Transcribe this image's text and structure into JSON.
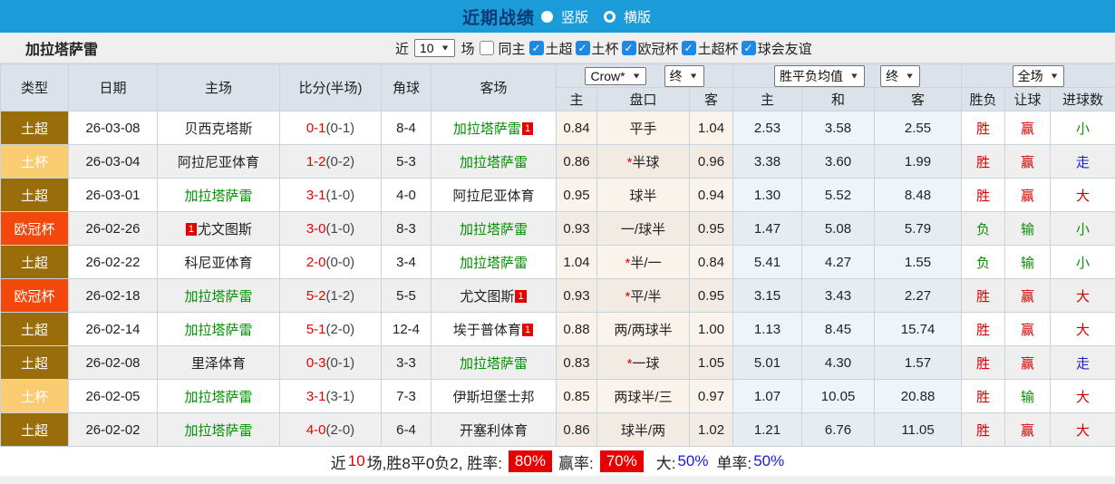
{
  "topbar": {
    "title": "近期战绩",
    "vertical_label": "竖版",
    "horizontal_label": "横版"
  },
  "filterbar": {
    "team": "加拉塔萨雷",
    "near_label": "近",
    "games_value": "10",
    "games_label": "场",
    "same_home_label": "同主",
    "leagues": [
      {
        "label": "土超",
        "checked": true
      },
      {
        "label": "土杯",
        "checked": true
      },
      {
        "label": "欧冠杯",
        "checked": true
      },
      {
        "label": "土超杯",
        "checked": true
      },
      {
        "label": "球会友谊",
        "checked": true
      }
    ],
    "check_glyph": "✓"
  },
  "table": {
    "headers_left": [
      "类型",
      "日期",
      "主场",
      "比分(半场)",
      "角球",
      "客场"
    ],
    "dropdowns": {
      "crow": "Crow*",
      "end1": "终",
      "avg": "胜平负均值",
      "end2": "终",
      "full": "全场"
    },
    "subheaders": [
      "主",
      "盘口",
      "客",
      "主",
      "和",
      "客",
      "胜负",
      "让球",
      "进球数"
    ],
    "rows": [
      {
        "type": "土超",
        "date": "26-03-08",
        "home": "贝西克塔斯",
        "home_green": false,
        "home_badge": "",
        "score": "0-1",
        "half": "(0-1)",
        "corner": "8-4",
        "away": "加拉塔萨雷",
        "away_green": true,
        "away_badge": "1",
        "odds_home": "0.84",
        "star": false,
        "handicap": "平手",
        "odds_away": "1.04",
        "avg_win": "2.53",
        "avg_draw": "3.58",
        "avg_lose": "2.55",
        "result_wdl": "胜",
        "result_handicap": "赢",
        "result_goals": "小"
      },
      {
        "type": "土杯",
        "date": "26-03-04",
        "home": "阿拉尼亚体育",
        "home_green": false,
        "home_badge": "",
        "score": "1-2",
        "half": "(0-2)",
        "corner": "5-3",
        "away": "加拉塔萨雷",
        "away_green": true,
        "away_badge": "",
        "odds_home": "0.86",
        "star": true,
        "handicap": "半球",
        "odds_away": "0.96",
        "avg_win": "3.38",
        "avg_draw": "3.60",
        "avg_lose": "1.99",
        "result_wdl": "胜",
        "result_handicap": "赢",
        "result_goals": "走"
      },
      {
        "type": "土超",
        "date": "26-03-01",
        "home": "加拉塔萨雷",
        "home_green": true,
        "home_badge": "",
        "score": "3-1",
        "half": "(1-0)",
        "corner": "4-0",
        "away": "阿拉尼亚体育",
        "away_green": false,
        "away_badge": "",
        "odds_home": "0.95",
        "star": false,
        "handicap": "球半",
        "odds_away": "0.94",
        "avg_win": "1.30",
        "avg_draw": "5.52",
        "avg_lose": "8.48",
        "result_wdl": "胜",
        "result_handicap": "赢",
        "result_goals": "大"
      },
      {
        "type": "欧冠杯",
        "date": "26-02-26",
        "home": "尤文图斯",
        "home_green": false,
        "home_badge": "1",
        "score": "3-0",
        "half": "(1-0)",
        "corner": "8-3",
        "away": "加拉塔萨雷",
        "away_green": true,
        "away_badge": "",
        "odds_home": "0.93",
        "star": false,
        "handicap": "一/球半",
        "odds_away": "0.95",
        "avg_win": "1.47",
        "avg_draw": "5.08",
        "avg_lose": "5.79",
        "result_wdl": "负",
        "result_handicap": "输",
        "result_goals": "小"
      },
      {
        "type": "土超",
        "date": "26-02-22",
        "home": "科尼亚体育",
        "home_green": false,
        "home_badge": "",
        "score": "2-0",
        "half": "(0-0)",
        "corner": "3-4",
        "away": "加拉塔萨雷",
        "away_green": true,
        "away_badge": "",
        "odds_home": "1.04",
        "star": true,
        "handicap": "半/一",
        "odds_away": "0.84",
        "avg_win": "5.41",
        "avg_draw": "4.27",
        "avg_lose": "1.55",
        "result_wdl": "负",
        "result_handicap": "输",
        "result_goals": "小"
      },
      {
        "type": "欧冠杯",
        "date": "26-02-18",
        "home": "加拉塔萨雷",
        "home_green": true,
        "home_badge": "",
        "score": "5-2",
        "half": "(1-2)",
        "corner": "5-5",
        "away": "尤文图斯",
        "away_green": false,
        "away_badge": "1",
        "odds_home": "0.93",
        "star": true,
        "handicap": "平/半",
        "odds_away": "0.95",
        "avg_win": "3.15",
        "avg_draw": "3.43",
        "avg_lose": "2.27",
        "result_wdl": "胜",
        "result_handicap": "赢",
        "result_goals": "大"
      },
      {
        "type": "土超",
        "date": "26-02-14",
        "home": "加拉塔萨雷",
        "home_green": true,
        "home_badge": "",
        "score": "5-1",
        "half": "(2-0)",
        "corner": "12-4",
        "away": "埃于普体育",
        "away_green": false,
        "away_badge": "1",
        "odds_home": "0.88",
        "star": false,
        "handicap": "两/两球半",
        "odds_away": "1.00",
        "avg_win": "1.13",
        "avg_draw": "8.45",
        "avg_lose": "15.74",
        "result_wdl": "胜",
        "result_handicap": "赢",
        "result_goals": "大"
      },
      {
        "type": "土超",
        "date": "26-02-08",
        "home": "里泽体育",
        "home_green": false,
        "home_badge": "",
        "score": "0-3",
        "half": "(0-1)",
        "corner": "3-3",
        "away": "加拉塔萨雷",
        "away_green": true,
        "away_badge": "",
        "odds_home": "0.83",
        "star": true,
        "handicap": "一球",
        "odds_away": "1.05",
        "avg_win": "5.01",
        "avg_draw": "4.30",
        "avg_lose": "1.57",
        "result_wdl": "胜",
        "result_handicap": "赢",
        "result_goals": "走"
      },
      {
        "type": "土杯",
        "date": "26-02-05",
        "home": "加拉塔萨雷",
        "home_green": true,
        "home_badge": "",
        "score": "3-1",
        "half": "(3-1)",
        "corner": "7-3",
        "away": "伊斯坦堡士邦",
        "away_green": false,
        "away_badge": "",
        "odds_home": "0.85",
        "star": false,
        "handicap": "两球半/三",
        "odds_away": "0.97",
        "avg_win": "1.07",
        "avg_draw": "10.05",
        "avg_lose": "20.88",
        "result_wdl": "胜",
        "result_handicap": "输",
        "result_goals": "大"
      },
      {
        "type": "土超",
        "date": "26-02-02",
        "home": "加拉塔萨雷",
        "home_green": true,
        "home_badge": "",
        "score": "4-0",
        "half": "(2-0)",
        "corner": "6-4",
        "away": "开塞利体育",
        "away_green": false,
        "away_badge": "",
        "odds_home": "0.86",
        "star": false,
        "handicap": "球半/两",
        "odds_away": "1.02",
        "avg_win": "1.21",
        "avg_draw": "6.76",
        "avg_lose": "11.05",
        "result_wdl": "胜",
        "result_handicap": "赢",
        "result_goals": "大"
      }
    ]
  },
  "footer": {
    "prefix": "近",
    "count": "10",
    "middle": "场,胜8平0负2, 胜率:",
    "win_rate": "80%",
    "label2": "赢率:",
    "rate2": "70%",
    "label3": "大:",
    "rate3": "50%",
    "label4": "单率:",
    "rate4": "50%"
  }
}
